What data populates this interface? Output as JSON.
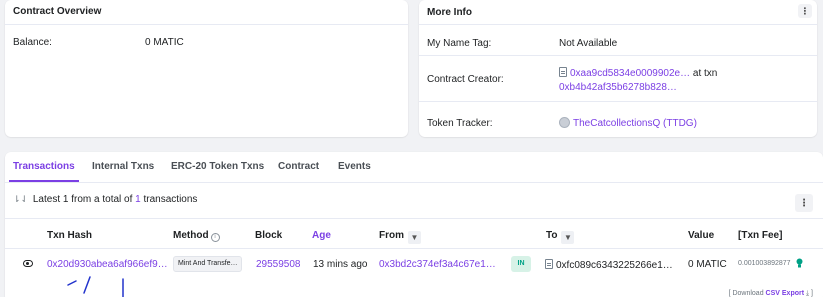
{
  "overview": {
    "title": "Contract Overview",
    "balance_label": "Balance:",
    "balance_value": "0 MATIC"
  },
  "more_info": {
    "title": "More Info",
    "kebab_glyph": "⋮",
    "name_tag_label": "My Name Tag:",
    "name_tag_value": "Not Available",
    "creator_label": "Contract Creator:",
    "creator_address": "0xaa9cd5834e0009902e…",
    "creator_at_txn": "at txn",
    "creator_txn": "0xb4b42af35b6278b828…",
    "token_tracker_label": "Token Tracker:",
    "token_tracker_value": "TheCatcollectionsQ (TTDG)"
  },
  "tabs": [
    {
      "label": "Transactions"
    },
    {
      "label": "Internal Txns"
    },
    {
      "label": "ERC-20 Token Txns"
    },
    {
      "label": "Contract"
    },
    {
      "label": "Events"
    }
  ],
  "summary": {
    "sort_glyph": "⇂⇃",
    "prefix": "Latest 1 from a total of",
    "count": "1",
    "suffix": "transactions"
  },
  "table": {
    "headers": {
      "txn_hash": "Txn Hash",
      "method": "Method",
      "block": "Block",
      "age": "Age",
      "from": "From",
      "to": "To",
      "value": "Value",
      "fee": "[Txn Fee]"
    },
    "rows": [
      {
        "txn_hash": "0x20d930abea6af966ef9…",
        "method": "Mint And Transfe…",
        "block": "29559508",
        "age": "13 mins ago",
        "from": "0x3bd2c374ef3a4c67e1…",
        "direction": "IN",
        "to": "0xfc089c6343225266e1…",
        "value": "0 MATIC",
        "fee": "0.001003892877"
      }
    ]
  },
  "download": {
    "prefix": "[ Download",
    "csv": "CSV Export",
    "suffix": "⤓ ]"
  },
  "colors": {
    "accent": "#7b3fe4",
    "in_badge_bg": "#d7f2e7",
    "in_badge_text": "#00a186",
    "background": "#f1f2f5"
  }
}
